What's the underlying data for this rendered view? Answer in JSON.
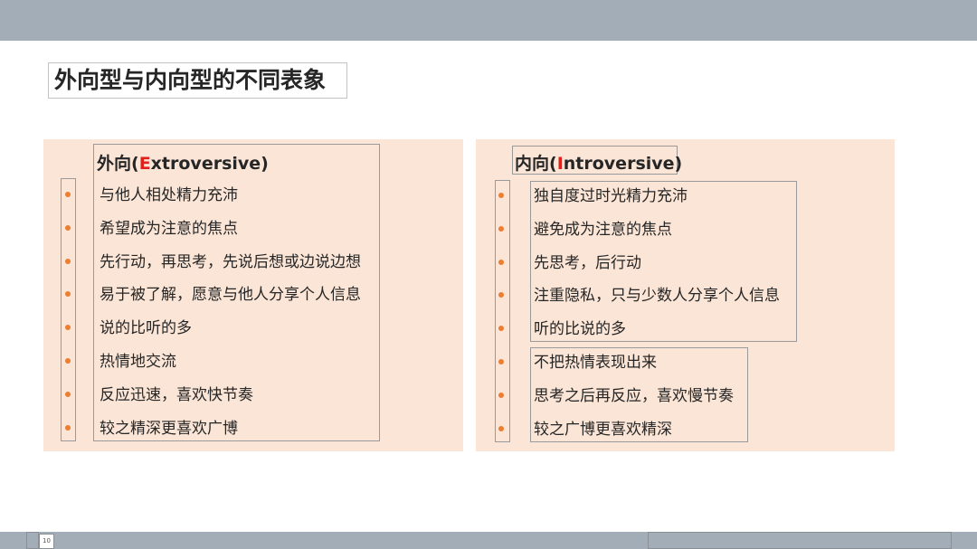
{
  "slide": {
    "title": "外向型与内向型的不同表象",
    "page_number": "10"
  },
  "extrovert": {
    "heading_prefix": "外向(",
    "heading_accent": "E",
    "heading_suffix": "xtroversive)",
    "items": [
      "与他人相处精力充沛",
      "希望成为注意的焦点",
      "先行动，再思考，先说后想或边说边想",
      "易于被了解，愿意与他人分享个人信息",
      "说的比听的多",
      "热情地交流",
      "反应迅速，喜欢快节奏",
      "较之精深更喜欢广博"
    ]
  },
  "introvert": {
    "heading_prefix": "内向(",
    "heading_accent": "I",
    "heading_suffix": "ntroversive)",
    "items": [
      "独自度过时光精力充沛",
      "避免成为注意的焦点",
      "先思考，后行动",
      "注重隐私，只与少数人分享个人信息",
      "听的比说的多",
      "不把热情表现出来",
      "思考之后再反应，喜欢慢节奏",
      "较之广博更喜欢精深"
    ]
  },
  "colors": {
    "panel_bg": "#fbe5d6",
    "bullet": "#ed7d31",
    "accent_letter": "#e0201b",
    "header_bar": "#a3adb8"
  }
}
